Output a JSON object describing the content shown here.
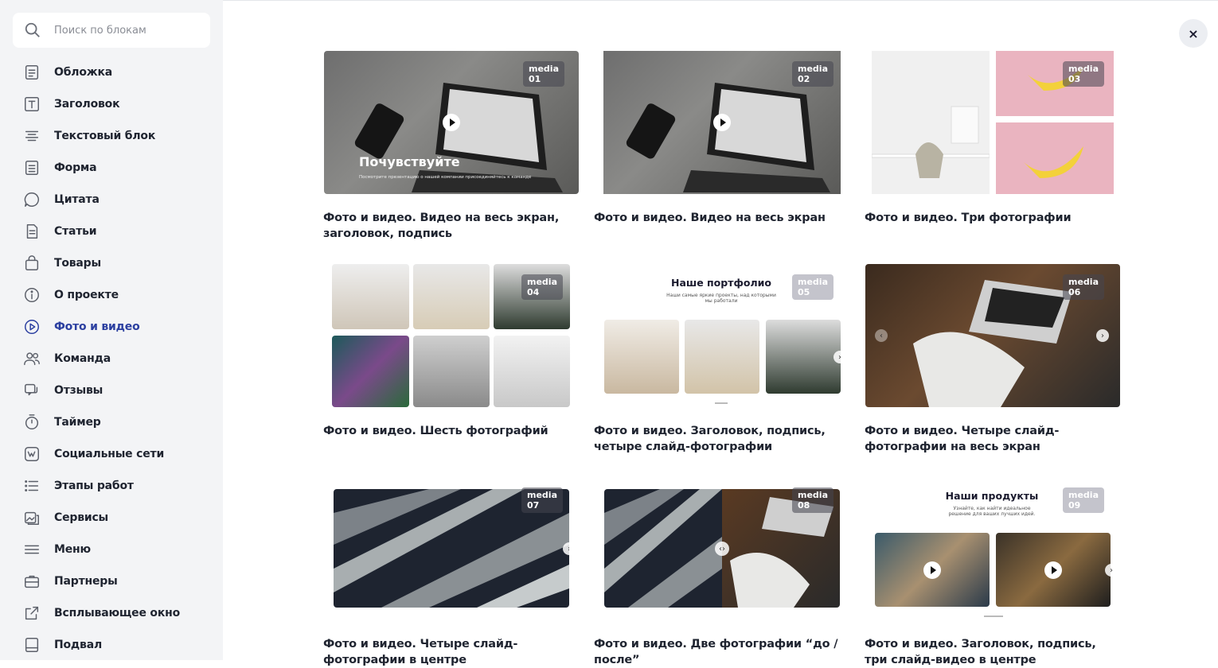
{
  "search": {
    "placeholder": "Поиск по блокам",
    "icon": "search-icon"
  },
  "sidebar": {
    "items": [
      {
        "label": "Обложка",
        "icon": "cover-icon"
      },
      {
        "label": "Заголовок",
        "icon": "heading-icon"
      },
      {
        "label": "Текстовый блок",
        "icon": "text-icon"
      },
      {
        "label": "Форма",
        "icon": "form-icon"
      },
      {
        "label": "Цитата",
        "icon": "quote-icon"
      },
      {
        "label": "Статьи",
        "icon": "articles-icon"
      },
      {
        "label": "Товары",
        "icon": "bag-icon"
      },
      {
        "label": "О проекте",
        "icon": "info-icon"
      },
      {
        "label": "Фото и видео",
        "icon": "play-circle-icon",
        "active": true
      },
      {
        "label": "Команда",
        "icon": "team-icon"
      },
      {
        "label": "Отзывы",
        "icon": "reviews-icon"
      },
      {
        "label": "Таймер",
        "icon": "timer-icon"
      },
      {
        "label": "Социальные сети",
        "icon": "vk-icon"
      },
      {
        "label": "Этапы работ",
        "icon": "list-icon"
      },
      {
        "label": "Сервисы",
        "icon": "services-icon"
      },
      {
        "label": "Меню",
        "icon": "menu-icon"
      },
      {
        "label": "Партнеры",
        "icon": "briefcase-icon"
      },
      {
        "label": "Всплывающее окно",
        "icon": "popup-icon"
      },
      {
        "label": "Подвал",
        "icon": "footer-icon"
      }
    ]
  },
  "close": {
    "label": "×"
  },
  "colors": {
    "accent": "#2b3fa0",
    "sidebar_bg": "#f3f4f6",
    "pink": "#eab4c0"
  },
  "cards": [
    {
      "badge": "media 01",
      "caption": "Фото и видео. Видео на весь экран, заголовок, подпись",
      "overlay_title": "Почувствуйте",
      "overlay_sub": "Посмотрите презентацию о нашей компании присоединяйтесь к команде"
    },
    {
      "badge": "media 02",
      "caption": "Фото и видео. Видео на весь экран"
    },
    {
      "badge": "media 03",
      "caption": "Фото и видео. Три фотографии"
    },
    {
      "badge": "media 04",
      "caption": "Фото и видео. Шесть фотографий"
    },
    {
      "badge": "media 05",
      "caption": "Фото и видео. Заголовок, подпись, четыре слайд-фотографии",
      "inner_title": "Наше портфолио",
      "inner_sub": "Наши самые яркие проекты, над которыми мы работали"
    },
    {
      "badge": "media 06",
      "caption": "Фото и видео. Четыре слайд-фотографии на весь экран"
    },
    {
      "badge": "media 07",
      "caption": "Фото и видео. Четыре слайд-фотографии в центре"
    },
    {
      "badge": "media 08",
      "caption": "Фото и видео. Две фотографии “до / после”"
    },
    {
      "badge": "media 09",
      "caption": "Фото и видео. Заголовок, подпись, три слайд-видео в центре",
      "inner_title": "Наши продукты",
      "inner_sub": "Узнайте, как найти идеальное решение для ваших лучших идей."
    }
  ]
}
